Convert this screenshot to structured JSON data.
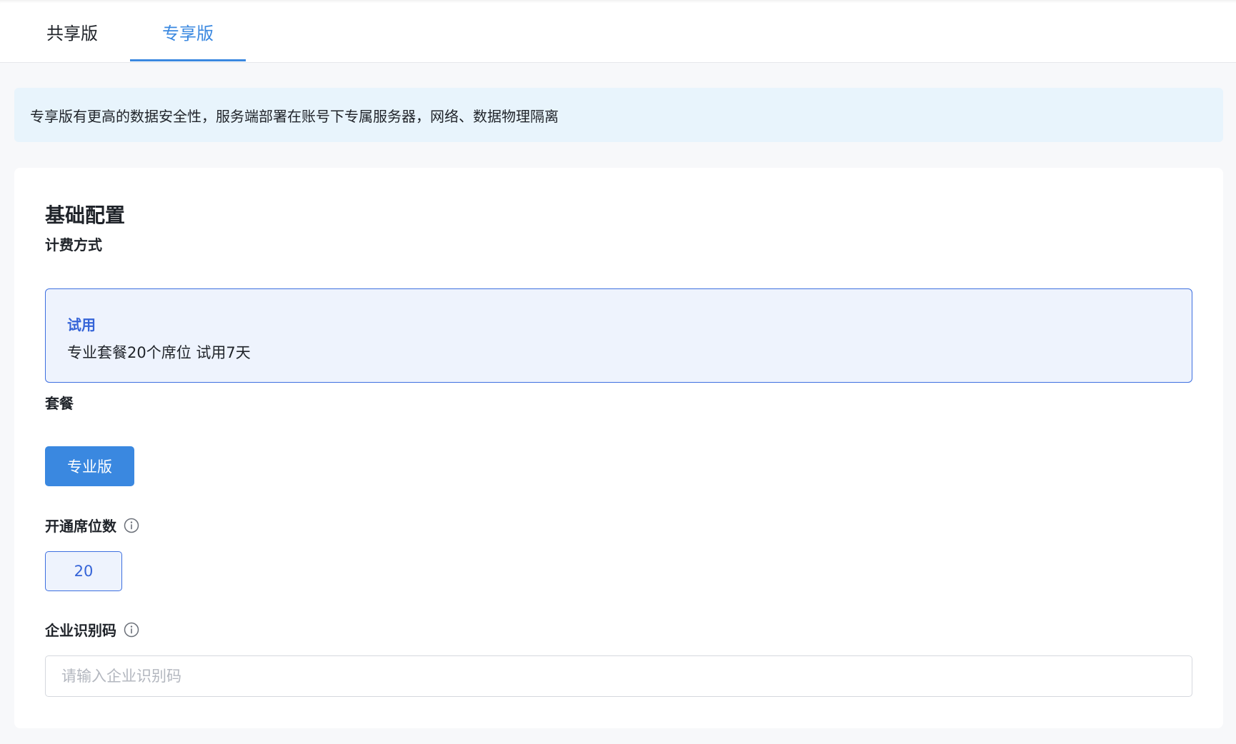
{
  "tabs": [
    {
      "label": "共享版",
      "active": false
    },
    {
      "label": "专享版",
      "active": true
    }
  ],
  "notice": {
    "text": "专享版有更高的数据安全性，服务端部署在账号下专属服务器，网络、数据物理隔离"
  },
  "config": {
    "section_title": "基础配置",
    "billing": {
      "label": "计费方式",
      "option_title": "试用",
      "option_desc": "专业套餐20个席位 试用7天"
    },
    "plan": {
      "label": "套餐",
      "selected": "专业版"
    },
    "seats": {
      "label": "开通席位数",
      "value": "20",
      "icon": "info-icon"
    },
    "enterprise_code": {
      "label": "企业识别码",
      "placeholder": "请输入企业识别码",
      "value": "",
      "icon": "info-icon"
    }
  },
  "colors": {
    "accent": "#3a88e0",
    "selected_border": "#3d6fe0",
    "notice_bg": "#e8f4fc"
  }
}
